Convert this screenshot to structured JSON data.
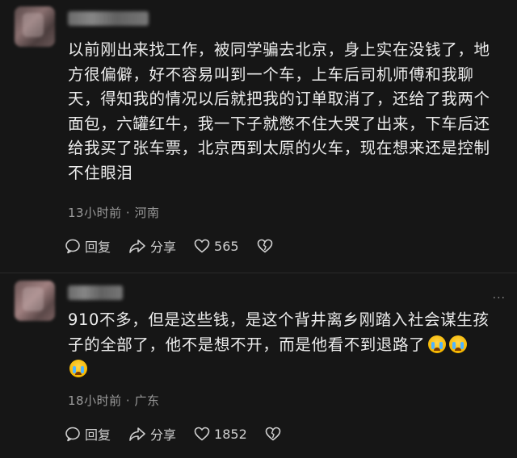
{
  "comments": [
    {
      "lines": [
        "以前刚出来找工作，被同学骗去北京，身上实在没钱了，地",
        "方很偏僻，好不容易叫到一个车，上车后司机师傅和我聊",
        "天，得知我的情况以后就把我的订单取消了，还给了我两个",
        "面包，六罐红牛，我一下子就憋不住大哭了出来，下车后还",
        "给我买了张车票，北京西到太原的火车，现在想来还是控制",
        "不住眼泪"
      ],
      "time": "13小时前",
      "location": "河南",
      "reply_label": "回复",
      "share_label": "分享",
      "like_count": "565"
    },
    {
      "lines": [
        "910不多，但是这些钱，是这个背井离乡刚踏入社会谋生孩",
        "子的全部了，他不是想不开，而是他看不到退路了",
        ""
      ],
      "emoji": "crying-face",
      "time": "18小时前",
      "location": "广东",
      "reply_label": "回复",
      "share_label": "分享",
      "like_count": "1852"
    }
  ],
  "more_symbol": "···",
  "separator": "·"
}
